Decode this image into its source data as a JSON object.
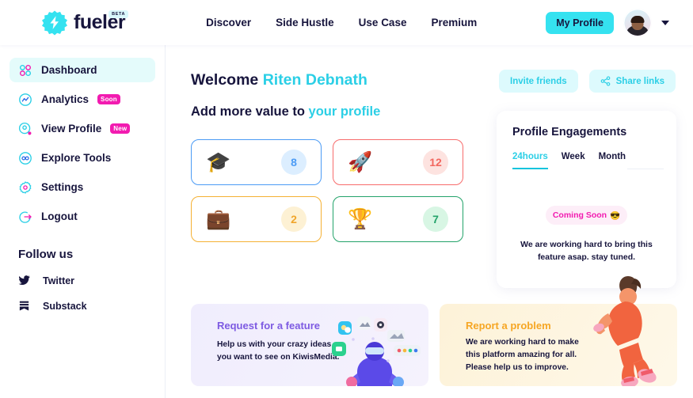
{
  "header": {
    "logo_text": "fueler",
    "logo_badge": "BETA",
    "logo_icon": "lightning-bolt-icon",
    "nav": [
      {
        "label": "Discover"
      },
      {
        "label": "Side Hustle"
      },
      {
        "label": "Use Case"
      },
      {
        "label": "Premium"
      }
    ],
    "my_profile_label": "My Profile",
    "avatar_name": "user-avatar",
    "dropdown_icon": "chevron-down-icon"
  },
  "sidebar": {
    "items": [
      {
        "label": "Dashboard",
        "icon": "grid-dots-icon",
        "badge": "",
        "active": true
      },
      {
        "label": "Analytics",
        "icon": "analytics-chart-icon",
        "badge": "Soon",
        "active": false
      },
      {
        "label": "View Profile",
        "icon": "location-pin-icon",
        "badge": "New",
        "active": false
      },
      {
        "label": "Explore Tools",
        "icon": "infinity-icon",
        "badge": "",
        "active": false
      },
      {
        "label": "Settings",
        "icon": "gear-icon",
        "badge": "",
        "active": false
      },
      {
        "label": "Logout",
        "icon": "logout-icon",
        "badge": "",
        "active": false
      }
    ],
    "follow_title": "Follow us",
    "socials": [
      {
        "label": "Twitter",
        "icon": "twitter-icon"
      },
      {
        "label": "Substack",
        "icon": "substack-icon"
      }
    ]
  },
  "main": {
    "welcome_prefix": "Welcome",
    "welcome_name": "Riten Debnath",
    "sub_prefix": "Add more value to",
    "sub_link": "your profile",
    "invite_label": "Invite friends",
    "share_label": "Share links",
    "share_icon": "share-nodes-icon",
    "stats": [
      {
        "emoji": "🎓",
        "icon": "graduation-cap-icon",
        "value": "8",
        "border": "#4b9bf5",
        "badge_bg": "#dceeff",
        "badge_color": "#4b9bf5"
      },
      {
        "emoji": "🚀",
        "icon": "rocket-icon",
        "value": "12",
        "border": "#f76c6c",
        "badge_bg": "#fde3e0",
        "badge_color": "#f2675f"
      },
      {
        "emoji": "💼",
        "icon": "briefcase-icon",
        "value": "2",
        "border": "#f5b133",
        "badge_bg": "#fdf1d4",
        "badge_color": "#f0a52b"
      },
      {
        "emoji": "🏆",
        "icon": "trophy-icon",
        "value": "7",
        "border": "#23a36a",
        "badge_bg": "#d8f6e4",
        "badge_color": "#23a36a"
      }
    ]
  },
  "engagements": {
    "title": "Profile Engagements",
    "tabs": [
      {
        "label": "24hours",
        "active": true
      },
      {
        "label": "Week",
        "active": false
      },
      {
        "label": "Month",
        "active": false
      }
    ],
    "coming_soon_label": "Coming Soon",
    "coming_soon_emoji": "😎",
    "note_line1": "We are working hard to bring this",
    "note_line2": "feature asap. stay tuned."
  },
  "promos": [
    {
      "title": "Request for a feature",
      "body": "Help us with your crazy ideas you want to see on KiwisMedia.",
      "art": "vr-person-illustration"
    },
    {
      "title": "Report a problem",
      "body": "We are working hard to make this platform amazing for all. Please help us to improve.",
      "art": "running-person-illustration"
    }
  ],
  "colors": {
    "accent_cyan": "#2bcfe6",
    "brand_cyan": "#35e2f0",
    "badge_pink": "#f21bb0",
    "navy": "#17153d"
  }
}
